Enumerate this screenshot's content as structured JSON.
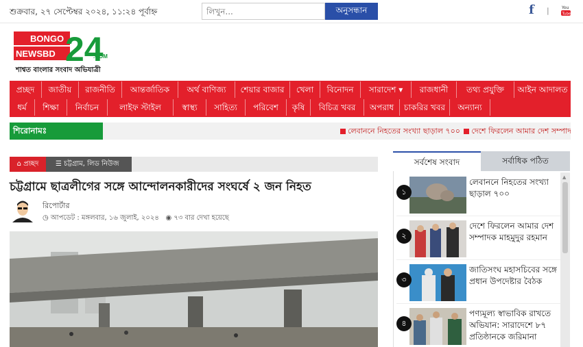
{
  "topbar": {
    "date": "শুক্রবার, ২৭ সেপ্টেম্বর ২০২৪, ১১:২৪ পূর্বাহ্ন",
    "search_placeholder": "লিখুন...",
    "search_button": "অনুসন্ধান",
    "separator": "|"
  },
  "logo": {
    "line1": "BONGO",
    "line2": "NEWSBD",
    "number": "24",
    "com": ".COM",
    "tagline": "শাশ্বত বাংলার সংবাদ অভিযাত্রী"
  },
  "nav": {
    "row1": [
      "প্রচ্ছদ",
      "জাতীয়",
      "রাজনীতি",
      "আন্তর্জাতিক",
      "অর্থ বাণিজ্য",
      "শেয়ার বাজার",
      "খেলা",
      "বিনোদন",
      "সারাদেশ ▾",
      "রাজধানী",
      "তথ্য প্রযুক্তি",
      "আইন আদালত"
    ],
    "row2": [
      "ধর্ম",
      "শিক্ষা",
      "নির্বাচন",
      "লাইফ স্টাইল",
      "স্বাস্থ্য",
      "সাহিত্য",
      "পরিবেশ",
      "কৃষি",
      "বিচিত্র খবর",
      "অপরাধ",
      "চাকরির খবর",
      "অন্যান্য"
    ]
  },
  "headlines": {
    "label": "শিরোনামঃ",
    "items": [
      "লেবাননে নিহতের সংখ্যা ছাড়াল ৭০০",
      "দেশে ফিরলেন আমার দেশ সম্পাদক"
    ]
  },
  "article": {
    "breadcrumb_home": "প্রচ্ছদ",
    "breadcrumb_category": "চট্টগ্রাম, লিড নিউজ",
    "title": "চট্টগ্রামে ছাত্রলীগের সঙ্গে আন্দোলনকারীদের সংঘর্ষে ২ জন নিহত",
    "author": "রিপোর্টার",
    "updated": "আপডেট : মঙ্গলবার, ১৬ জুলাই, ২০২৪",
    "views": "৭৩ বার দেখা হয়েছে"
  },
  "sidebar": {
    "tab_latest": "সর্বশেষ সংবাদ",
    "tab_most_read": "সর্বাধিক পঠিত",
    "items": [
      {
        "num": "১",
        "text": "লেবাননে নিহতের সংখ্যা ছাড়াল ৭০০"
      },
      {
        "num": "২",
        "text": "দেশে ফিরলেন আমার দেশ সম্পাদক মাহমুদুর রহমান"
      },
      {
        "num": "৩",
        "text": "জাতিসংঘ মহাসচিবের সঙ্গে প্রধান উপদেষ্টার বৈঠক"
      },
      {
        "num": "৪",
        "text": "পণ্যমূল্য স্বাভাবিক রাখতে অভিযান: সারাদেশে ৮৭ প্রতিষ্ঠানকে জরিমানা"
      }
    ]
  },
  "colors": {
    "nav_red": "#e3202b",
    "headline_green": "#179b3a",
    "search_blue": "#2a4fa8"
  }
}
